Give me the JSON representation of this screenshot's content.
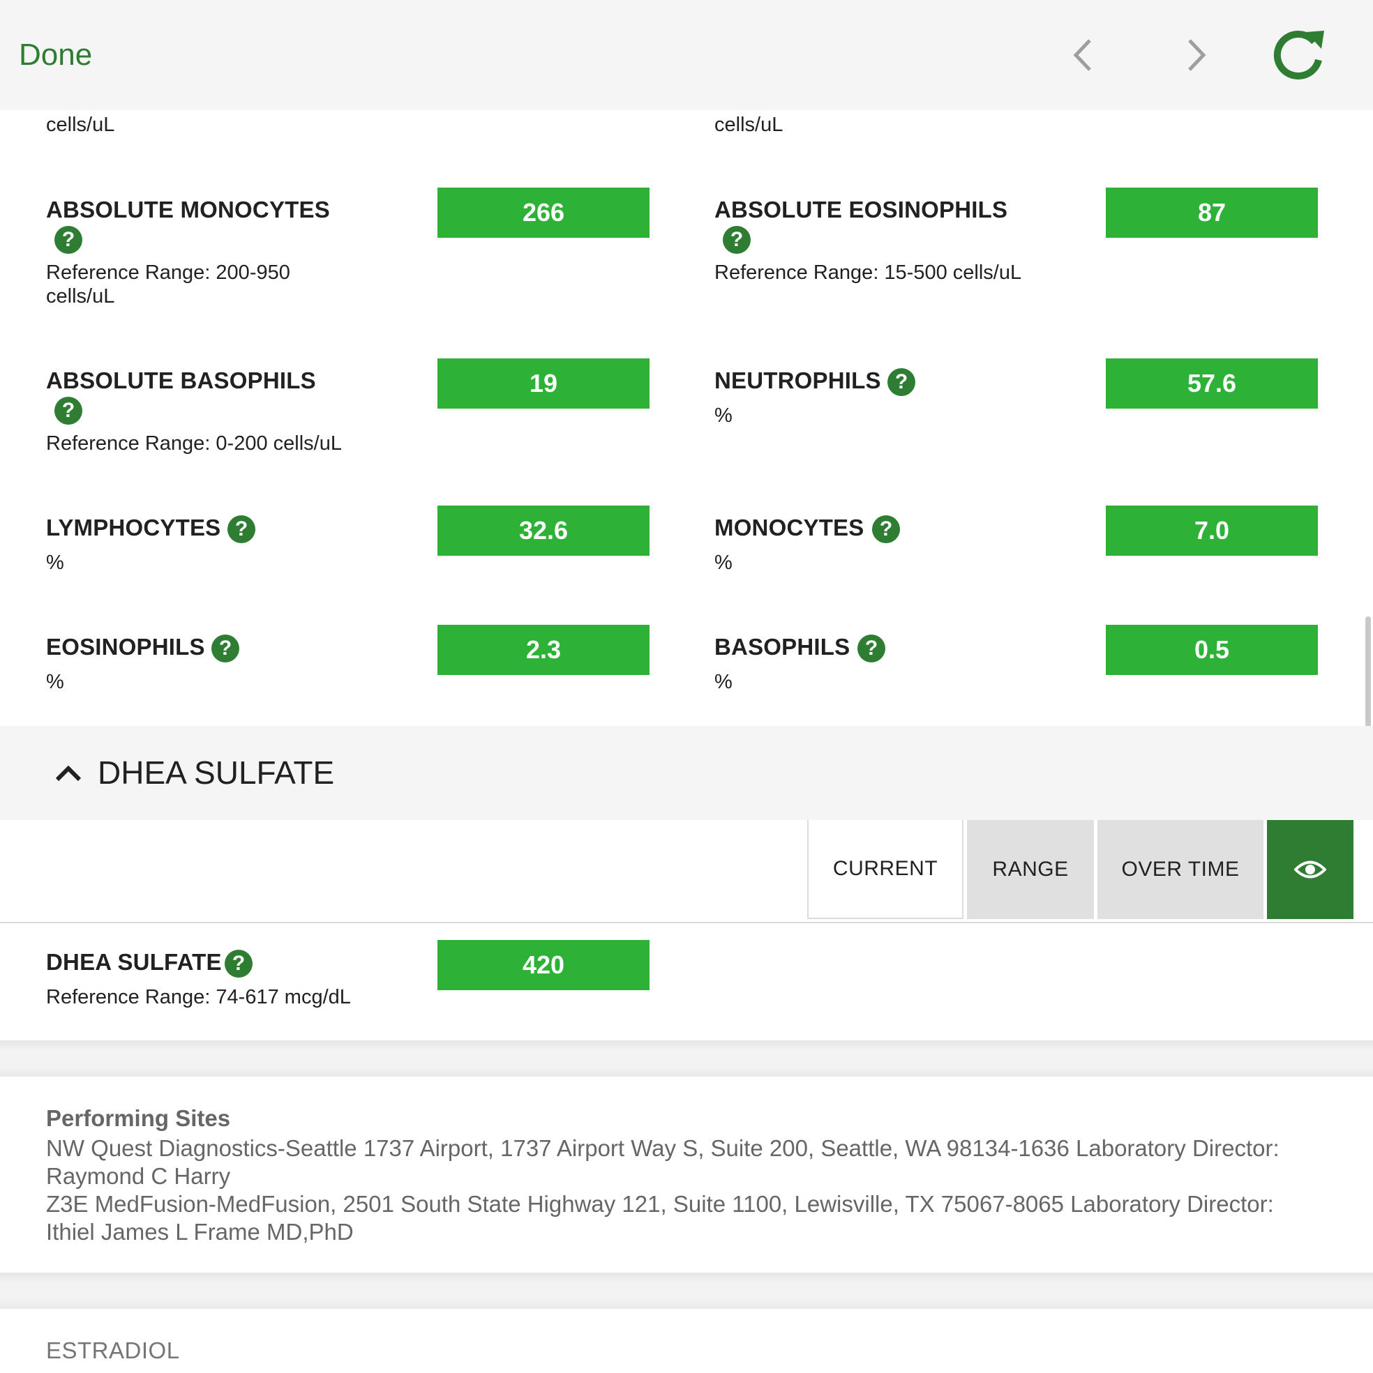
{
  "toolbar": {
    "done_label": "Done",
    "accent_color": "#2e7d32",
    "icons": [
      "chevron-left-icon",
      "chevron-right-icon",
      "refresh-icon"
    ]
  },
  "previous_rows_cut": {
    "left_unit": "cells/uL",
    "right_unit": "cells/uL"
  },
  "results": [
    {
      "name": "ABSOLUTE MONOCYTES",
      "value": "266",
      "ref_line1": "Reference Range: 200-950",
      "ref_line2": "cells/uL"
    },
    {
      "name": "ABSOLUTE EOSINOPHILS",
      "value": "87",
      "ref_line1": "Reference Range: 15-500 cells/uL"
    },
    {
      "name": "ABSOLUTE BASOPHILS",
      "value": "19",
      "ref_line1": "Reference Range: 0-200 cells/uL"
    },
    {
      "name": "NEUTROPHILS",
      "value": "57.6",
      "unit": "%"
    },
    {
      "name": "LYMPHOCYTES",
      "value": "32.6",
      "unit": "%"
    },
    {
      "name": "MONOCYTES",
      "value": "7.0",
      "unit": "%"
    },
    {
      "name": "EOSINOPHILS",
      "value": "2.3",
      "unit": "%"
    },
    {
      "name": "BASOPHILS",
      "value": "0.5",
      "unit": "%"
    }
  ],
  "help_icon_glyph": "?",
  "section": {
    "title": "DHEA SULFATE",
    "tabs": [
      "CURRENT",
      "RANGE",
      "OVER TIME"
    ],
    "selected_tab": "CURRENT",
    "result": {
      "name": "DHEA SULFATE",
      "value": "420",
      "ref": "Reference Range: 74-617 mcg/dL"
    }
  },
  "performing_sites": {
    "label": "Performing Sites",
    "lines": [
      "NW Quest Diagnostics-Seattle 1737 Airport, 1737 Airport Way S, Suite 200, Seattle, WA 98134-1636 Laboratory Director:",
      "Raymond C Harry",
      "Z3E MedFusion-MedFusion, 2501 South State Highway 121, Suite 1100, Lewisville, TX 75067-8065 Laboratory Director:",
      "Ithiel James L Frame MD,PhD"
    ]
  },
  "next_section": {
    "title": "ESTRADIOL"
  },
  "value_box_color": "#2db136"
}
